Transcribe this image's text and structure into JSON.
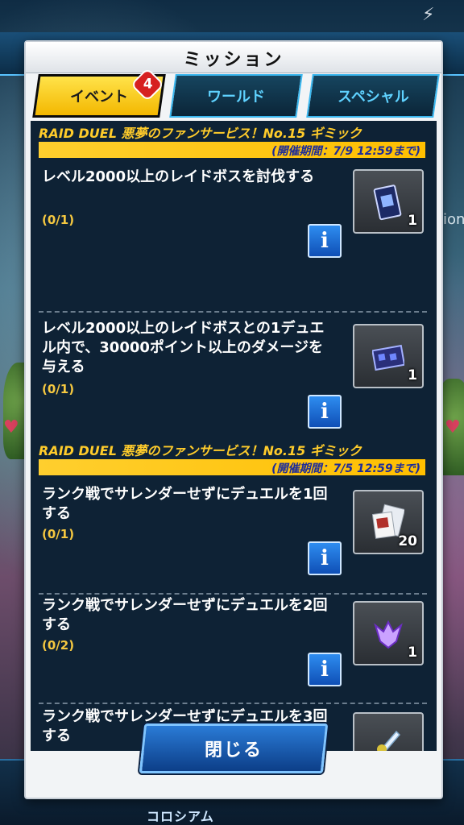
{
  "modal": {
    "title": "ミッション",
    "close_label": "閉じる"
  },
  "tabs": [
    {
      "label": "イベント",
      "active": true,
      "badge": "4"
    },
    {
      "label": "ワールド",
      "active": false
    },
    {
      "label": "スペシャル",
      "active": false
    }
  ],
  "sections": [
    {
      "title": "RAID DUEL 悪夢のファンサービス！No.15 ギミック",
      "period": "(開催期間：7/9 12:59まで)",
      "missions": [
        {
          "text": "レベル2000以上のレイドボスを討伐する",
          "progress": "(0/1)",
          "reward_icon": "card-pack-icon",
          "reward_count": "1"
        },
        {
          "text": "レベル2000以上のレイドボスとの1デュエル内で、30000ポイント以上のダメージを与える",
          "progress": "(0/1)",
          "reward_icon": "card-sleeve-icon",
          "reward_count": "1"
        }
      ]
    },
    {
      "title": "RAID DUEL 悪夢のファンサービス！No.15 ギミック",
      "period": "(開催期間：7/5 12:59まで)",
      "missions": [
        {
          "text": "ランク戦でサレンダーせずにデュエルを1回する",
          "progress": "(0/1)",
          "reward_icon": "card-tickets-icon",
          "reward_count": "20"
        },
        {
          "text": "ランク戦でサレンダーせずにデュエルを2回する",
          "progress": "(0/2)",
          "reward_icon": "purple-emblem-icon",
          "reward_count": "1"
        },
        {
          "text": "ランク戦でサレンダーせずにデュエルを3回する",
          "progress": "",
          "reward_icon": "sword-skill-icon",
          "reward_count": ""
        }
      ]
    }
  ],
  "background": {
    "bottom_nav_label": "コロシアム",
    "partial_text": "ion"
  }
}
